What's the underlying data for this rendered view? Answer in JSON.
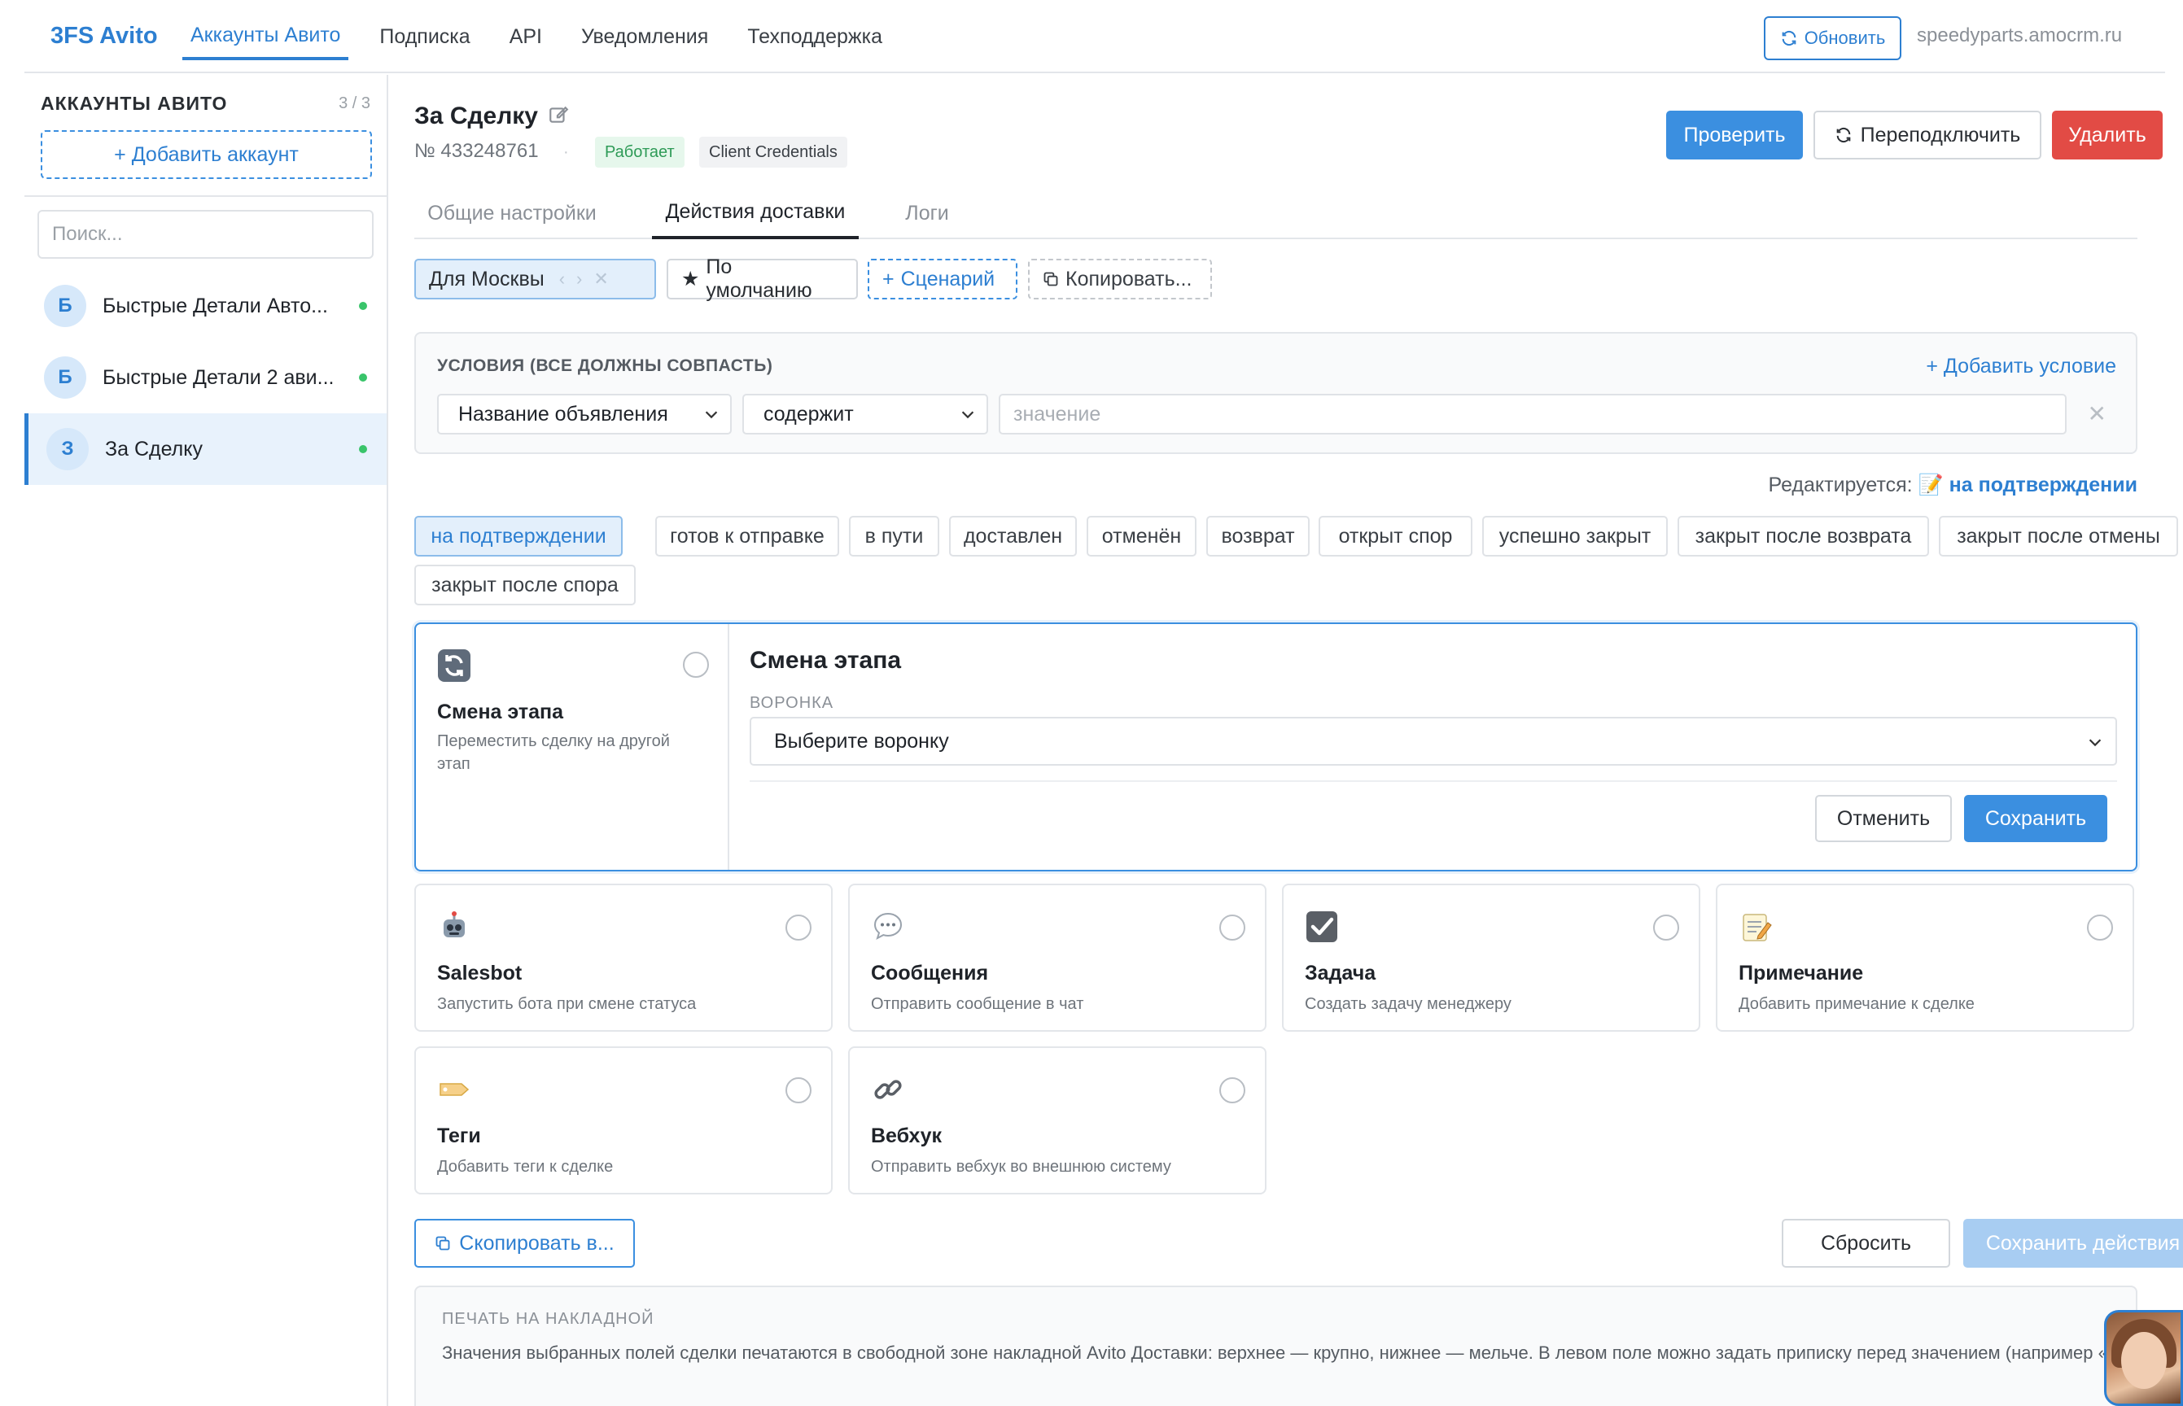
{
  "topnav": {
    "brand": "3FS Avito",
    "links": [
      "Аккаунты Авито",
      "Подписка",
      "API",
      "Уведомления",
      "Техподдержка"
    ],
    "refresh_label": "Обновить",
    "domain": "speedyparts.amocrm.ru"
  },
  "sidebar": {
    "title": "АККАУНТЫ АВИТО",
    "count": "3 / 3",
    "add_label": "+ Добавить аккаунт",
    "search_placeholder": "Поиск...",
    "accounts": [
      {
        "initial": "Б",
        "name": "Быстрые Детали Авто...",
        "status_color": "#39c46a"
      },
      {
        "initial": "Б",
        "name": "Быстрые Детали 2 ави...",
        "status_color": "#39c46a"
      },
      {
        "initial": "З",
        "name": "За Сделку",
        "status_color": "#39c46a",
        "active": true
      }
    ]
  },
  "account": {
    "title": "За Сделку",
    "number": "№ 433248761",
    "status_badge": "Работает",
    "auth_badge": "Client Credentials",
    "check_label": "Проверить",
    "reconnect_label": "Переподключить",
    "delete_label": "Удалить"
  },
  "tabs": [
    "Общие настройки",
    "Действия доставки",
    "Логи"
  ],
  "scenarios": {
    "current": "Для Москвы",
    "default_label": "По умолчанию",
    "add_label": "Сценарий",
    "copy_label": "Копировать..."
  },
  "conditions": {
    "title": "УСЛОВИЯ (ВСЕ ДОЛЖНЫ СОВПАСТЬ)",
    "add_label": "+ Добавить условие",
    "field": "Название объявления",
    "operator": "содержит",
    "value_placeholder": "значение"
  },
  "editing": {
    "prefix": "Редактируется:",
    "status": "на подтверждении"
  },
  "statuses": [
    "на подтверждении",
    "готов к отправке",
    "в пути",
    "доставлен",
    "отменён",
    "возврат",
    "открыт спор",
    "успешно закрыт",
    "закрыт после возврата",
    "закрыт после отмены",
    "закрыт после спора"
  ],
  "selected_action": {
    "title": "Смена этапа",
    "desc": "Переместить сделку на другой этап",
    "panel_title": "Смена этапа",
    "field_label": "ВОРОНКА",
    "funnel_value": "Выберите воронку",
    "cancel_label": "Отменить",
    "save_label": "Сохранить"
  },
  "actions": [
    {
      "icon": "robot-icon",
      "title": "Salesbot",
      "desc": "Запустить бота при смене статуса"
    },
    {
      "icon": "speech-bubble-icon",
      "title": "Сообщения",
      "desc": "Отправить сообщение в чат"
    },
    {
      "icon": "checkbox-icon",
      "title": "Задача",
      "desc": "Создать задачу менеджеру"
    },
    {
      "icon": "memo-icon",
      "title": "Примечание",
      "desc": "Добавить примечание к сделке"
    },
    {
      "icon": "tag-icon",
      "title": "Теги",
      "desc": "Добавить теги к сделке"
    },
    {
      "icon": "link-icon",
      "title": "Вебхук",
      "desc": "Отправить вебхук во внешнюю систему"
    }
  ],
  "bottom": {
    "copy_to_label": "Скопировать в...",
    "reset_label": "Сбросить",
    "save_actions_label": "Сохранить действия"
  },
  "print": {
    "title": "ПЕЧАТЬ НА НАКЛАДНОЙ",
    "text": "Значения выбранных полей сделки печатаются в свободной зоне накладной Avito Доставки: верхнее — крупно, нижнее — мельче. В левом поле можно задать приписку перед значением (например «art:»)."
  },
  "colors": {
    "accent": "#2d7fd1",
    "primary_button": "#3b8fe0",
    "danger": "#e24b45",
    "success": "#39c46a"
  }
}
